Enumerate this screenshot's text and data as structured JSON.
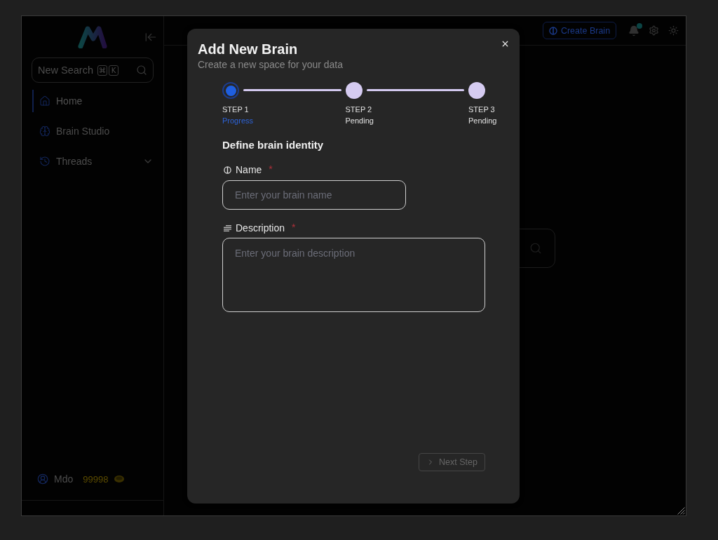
{
  "sidebar": {
    "search": {
      "placeholder": "New Search",
      "shortcut_keys": [
        "⌘",
        "K"
      ]
    },
    "nav_items": [
      {
        "kind": "link",
        "label": "Home",
        "selected": true
      },
      {
        "kind": "link",
        "label": "Brain Studio",
        "selected": false
      },
      {
        "kind": "group",
        "label": "Threads",
        "selected": false,
        "expanded": false
      }
    ],
    "user": {
      "name": "Mdo",
      "credits": "99998"
    }
  },
  "top_bar": {
    "create_button": "Create Brain"
  },
  "modal": {
    "title": "Add New Brain",
    "subtitle": "Create a new space for your data",
    "steps": [
      {
        "label": "STEP 1",
        "status": "Progress",
        "current": true
      },
      {
        "label": "STEP 2",
        "status": "Pending",
        "current": false
      },
      {
        "label": "STEP 3",
        "status": "Pending",
        "current": false
      }
    ],
    "section_title": "Define brain identity",
    "fields": [
      {
        "kind": "input",
        "label": "Name",
        "required_mark": "*",
        "placeholder": "Enter your brain name"
      },
      {
        "kind": "textarea",
        "label": "Description",
        "required_mark": "*",
        "placeholder": "Enter your brain description"
      }
    ],
    "next_button": {
      "label": "Next Step",
      "disabled": true
    }
  }
}
